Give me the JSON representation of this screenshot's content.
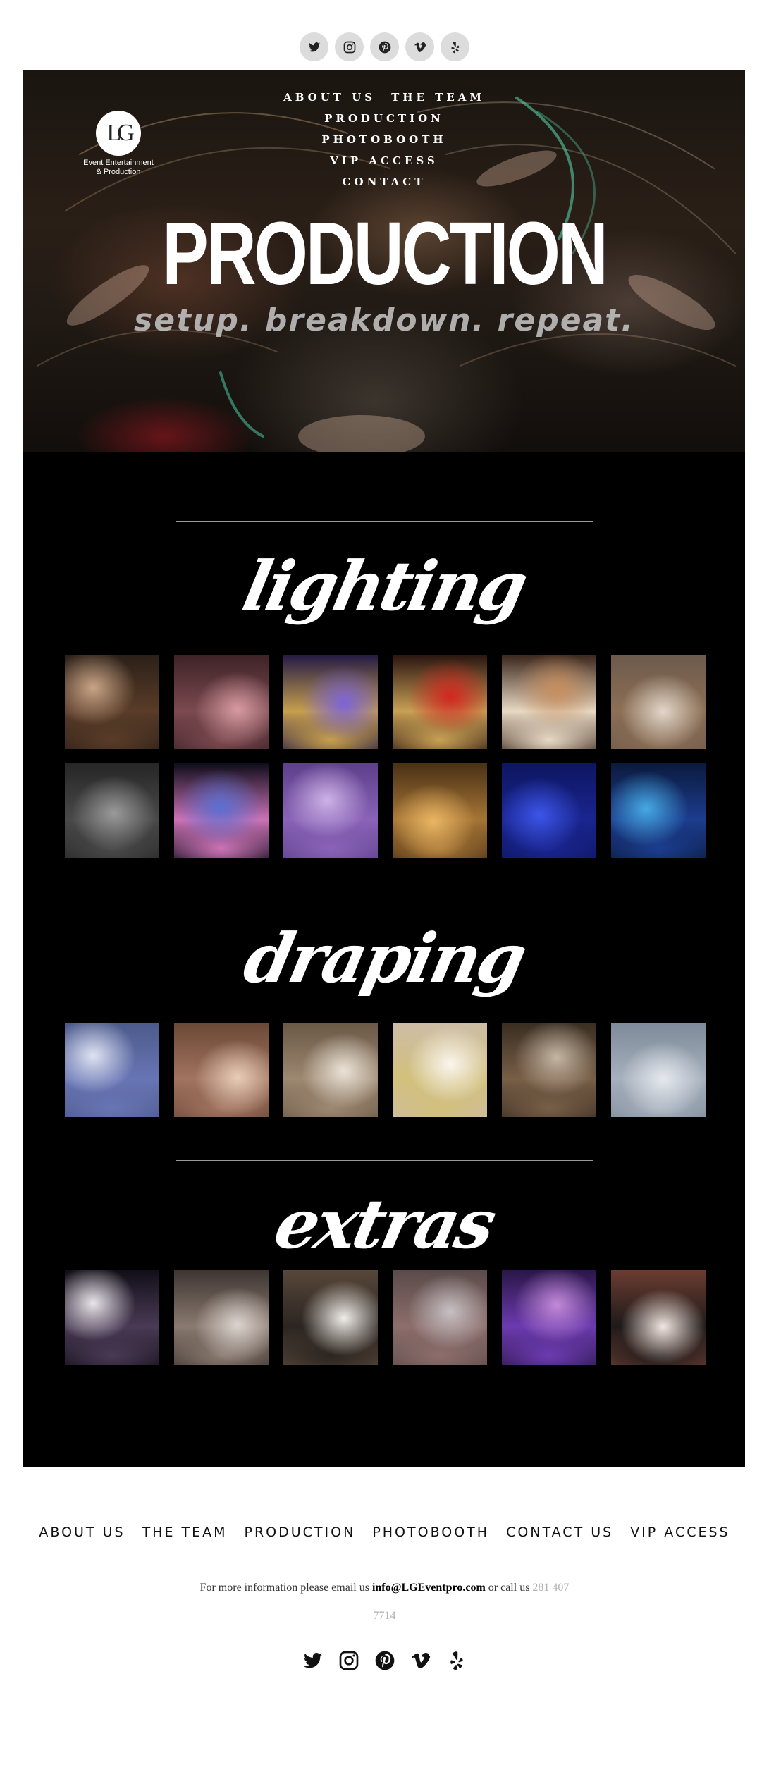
{
  "social": {
    "icons": [
      "twitter-icon",
      "instagram-icon",
      "pinterest-icon",
      "vimeo-icon",
      "yelp-icon"
    ]
  },
  "hero": {
    "logo_mark": "LG",
    "logo_line1": "Event Entertainment",
    "logo_line2": "& Production",
    "nav_row1": [
      "ABOUT US",
      "THE TEAM"
    ],
    "nav_rest": [
      "PRODUCTION",
      "PHOTOBOOTH",
      "VIP ACCESS",
      "CONTACT"
    ],
    "title": "PRODUCTION",
    "subtitle": "setup. breakdown. repeat."
  },
  "sections": {
    "lighting": {
      "heading": "lighting",
      "photos": [
        {
          "name": "photo-lighting-floral-arch",
          "colors": [
            "#2b2018",
            "#c9a587",
            "#5a3c28"
          ]
        },
        {
          "name": "photo-lighting-pink-monogram",
          "colors": [
            "#3d2226",
            "#d79aa2",
            "#7b4a50"
          ]
        },
        {
          "name": "photo-lighting-purple-party",
          "colors": [
            "#231a45",
            "#7b63d8",
            "#c79f4d"
          ]
        },
        {
          "name": "photo-lighting-red-cake",
          "colors": [
            "#2a1510",
            "#d3261f",
            "#c8a055"
          ]
        },
        {
          "name": "photo-lighting-gobo-monogram",
          "colors": [
            "#3a261b",
            "#c78e5e",
            "#e8d9c4"
          ]
        },
        {
          "name": "photo-lighting-ballroom-white",
          "colors": [
            "#6c5a4c",
            "#e2d6c9",
            "#8d6f55"
          ]
        },
        {
          "name": "photo-lighting-wall-monogram",
          "colors": [
            "#262626",
            "#9a9a9a",
            "#4a4a4a"
          ]
        },
        {
          "name": "photo-lighting-led-dancefloor",
          "colors": [
            "#0f0d1a",
            "#5a6fd1",
            "#cc73b6"
          ]
        },
        {
          "name": "photo-lighting-lavender-hall",
          "colors": [
            "#5d3f8a",
            "#cdb2e6",
            "#8a63b8"
          ]
        },
        {
          "name": "photo-lighting-gold-firstdance",
          "colors": [
            "#4a3116",
            "#e9b563",
            "#a67535"
          ]
        },
        {
          "name": "photo-lighting-blue-reception",
          "colors": [
            "#0d1660",
            "#3c55e8",
            "#1a2590"
          ]
        },
        {
          "name": "photo-lighting-blue-dancefloor",
          "colors": [
            "#0b1a3d",
            "#46a9e3",
            "#1c3d8f"
          ]
        }
      ]
    },
    "draping": {
      "heading": "draping",
      "photos": [
        {
          "name": "photo-draping-blue-chairs",
          "colors": [
            "#4c5a8a",
            "#dfe4f2",
            "#6875b5"
          ]
        },
        {
          "name": "photo-draping-tan-drapes",
          "colors": [
            "#6a4836",
            "#e8cdb8",
            "#a27460"
          ]
        },
        {
          "name": "photo-draping-white-tables",
          "colors": [
            "#6a5845",
            "#ebe3d8",
            "#9d8871"
          ]
        },
        {
          "name": "photo-draping-ceremony-arch",
          "colors": [
            "#cdbda6",
            "#fbf6ee",
            "#d2c07b"
          ]
        },
        {
          "name": "photo-draping-stage",
          "colors": [
            "#3a2d22",
            "#c4b5a3",
            "#785f47"
          ]
        },
        {
          "name": "photo-draping-aisle-chairs",
          "colors": [
            "#7d8a99",
            "#e5e9ee",
            "#a7b0bd"
          ]
        }
      ]
    },
    "extras": {
      "heading": "extras",
      "photos": [
        {
          "name": "photo-extras-sparklers",
          "colors": [
            "#120f18",
            "#e9e5ea",
            "#4a3a55"
          ]
        },
        {
          "name": "photo-extras-fog-dance",
          "colors": [
            "#3e3531",
            "#dbd3ce",
            "#8a7a70"
          ]
        },
        {
          "name": "photo-extras-first-dance-clouds",
          "colors": [
            "#574739",
            "#f0ede9",
            "#2b2521"
          ]
        },
        {
          "name": "photo-extras-crowd-cheer",
          "colors": [
            "#5a4b4a",
            "#c7c0c3",
            "#8d6e6c"
          ]
        },
        {
          "name": "photo-extras-purple-celebration",
          "colors": [
            "#2a1647",
            "#c38ad9",
            "#6c3bb0"
          ]
        },
        {
          "name": "photo-extras-couple-fog",
          "colors": [
            "#6b3c31",
            "#f2e6e0",
            "#1e1a1a"
          ]
        }
      ]
    }
  },
  "footer": {
    "nav": [
      "ABOUT US",
      "THE TEAM",
      "PRODUCTION",
      "PHOTOBOOTH",
      "CONTACT US",
      "VIP ACCESS"
    ],
    "info_prefix": "For more information please email us",
    "email": "info@LGEventpro.com",
    "info_mid": "or call us",
    "phone_part1": "281 407",
    "phone_part2": "7714"
  }
}
